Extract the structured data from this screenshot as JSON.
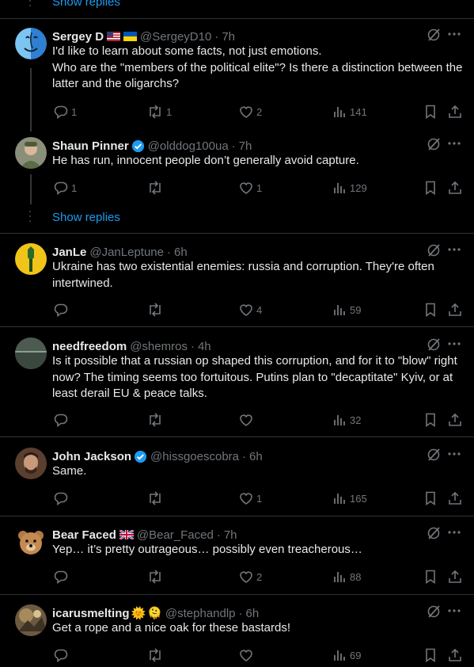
{
  "top": {
    "show_replies": "Show replies"
  },
  "replies_link": {
    "label": "Show replies"
  },
  "tweets": [
    {
      "name": "Sergey D",
      "handle": "@SergeyD10",
      "time": "7h",
      "text": "I'd like to learn about some facts, not just emotions.\nWho are the \"members of the political elite\"? Is there a distinction between the latter and the oligarchs?",
      "replies": "1",
      "reposts": "1",
      "likes": "2",
      "views": "141"
    },
    {
      "name": "Shaun Pinner",
      "handle": "@olddog100ua",
      "time": "7h",
      "text": "He has run, innocent people don’t generally avoid capture.",
      "replies": "1",
      "reposts": "",
      "likes": "1",
      "views": "129"
    },
    {
      "name": "JanLe",
      "handle": "@JanLeptune",
      "time": "6h",
      "text": "Ukraine has two existential enemies: russia and corruption. They're often intertwined.",
      "replies": "",
      "reposts": "",
      "likes": "4",
      "views": "59"
    },
    {
      "name": "needfreedom",
      "handle": "@shemros",
      "time": "4h",
      "text": "Is it possible that a russian op shaped this corruption, and for it to \"blow\" right now? The timing seems too fortuitous. Putins plan to \"decaptitate\" Kyiv, or at least derail EU & peace talks.",
      "replies": "",
      "reposts": "",
      "likes": "",
      "views": "32"
    },
    {
      "name": "John Jackson",
      "handle": "@hissgoescobra",
      "time": "6h",
      "text": "Same.",
      "replies": "",
      "reposts": "",
      "likes": "1",
      "views": "165"
    },
    {
      "name": "Bear Faced",
      "handle": "@Bear_Faced",
      "time": "7h",
      "text": "Yep… it’s pretty outrageous… possibly even treacherous…",
      "replies": "",
      "reposts": "",
      "likes": "2",
      "views": "88"
    },
    {
      "name": "icarusmelting",
      "handle": "@stephandlp",
      "time": "6h",
      "text": "Get a rope and a nice oak for these bastards!",
      "replies": "",
      "reposts": "",
      "likes": "",
      "views": "69"
    }
  ],
  "emoji": {
    "sun": "🌞",
    "hug": "🫠"
  }
}
